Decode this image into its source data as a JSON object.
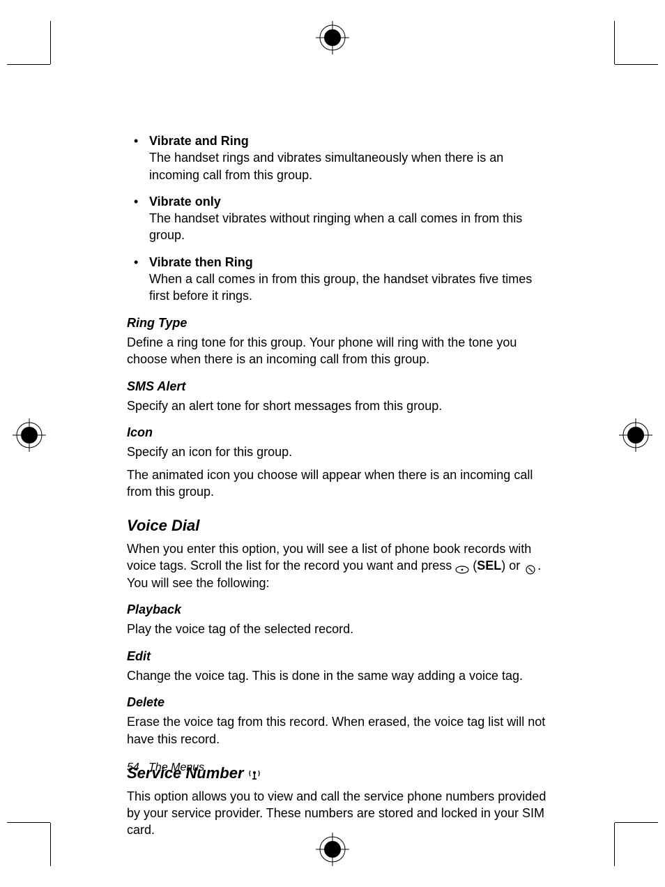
{
  "bullets": [
    {
      "title": "Vibrate and Ring",
      "body": "The handset rings and vibrates simultaneously when there is an incoming call from this group."
    },
    {
      "title": "Vibrate only",
      "body": "The handset vibrates without ringing when a call comes in from this group."
    },
    {
      "title": "Vibrate then Ring",
      "body": "When a call comes in from this group, the handset vibrates five times first before it rings."
    }
  ],
  "ringType": {
    "heading": "Ring Type",
    "body": "Define a ring tone for this group. Your phone will ring with the tone you choose when there is an incoming call from this group."
  },
  "smsAlert": {
    "heading": "SMS Alert",
    "body": "Specify an alert tone for short messages from this group."
  },
  "icon": {
    "heading": "Icon",
    "body1": "Specify an icon for this group.",
    "body2": "The animated icon you choose will appear when there is an incoming call from this group."
  },
  "voiceDial": {
    "heading": "Voice Dial",
    "intro1": "When you enter this option, you will see a list of phone book records with voice tags. Scroll the list for the record you want and press ",
    "sel": "SEL",
    "intro2": ") or ",
    "intro3": ". You will see the following:"
  },
  "playback": {
    "heading": "Playback",
    "body": "Play the voice tag of the selected record."
  },
  "edit": {
    "heading": "Edit",
    "body": "Change the voice tag. This is done in the same way adding a voice tag."
  },
  "delete": {
    "heading": "Delete",
    "body": "Erase the voice tag from this record. When erased, the voice tag list will not have this record."
  },
  "serviceNumber": {
    "heading": "Service Number",
    "body": "This option allows you to view and call the service phone numbers provided by your service provider. These numbers are stored and locked in your SIM card."
  },
  "footer": {
    "page": "54",
    "section": "The Menus"
  }
}
